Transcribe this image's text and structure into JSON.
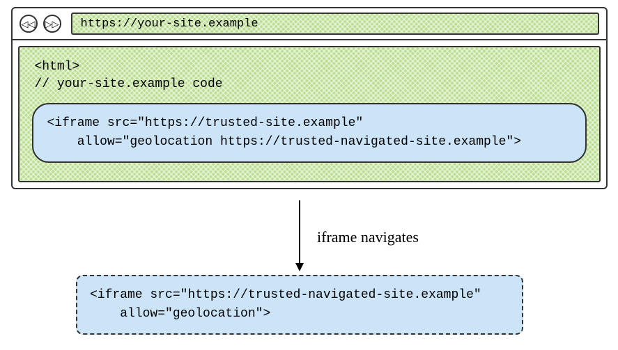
{
  "browser": {
    "back_glyph": "◁◁",
    "fwd_glyph": "▷▷",
    "url": "https://your-site.example"
  },
  "site": {
    "code": "<html>\n// your-site.example code",
    "iframe1": "<iframe src=\"https://trusted-site.example\"\n    allow=\"geolocation https://trusted-navigated-site.example\">"
  },
  "arrow": {
    "label": "iframe navigates"
  },
  "navigated": {
    "iframe2": "<iframe src=\"https://trusted-navigated-site.example\"\n    allow=\"geolocation\">"
  }
}
